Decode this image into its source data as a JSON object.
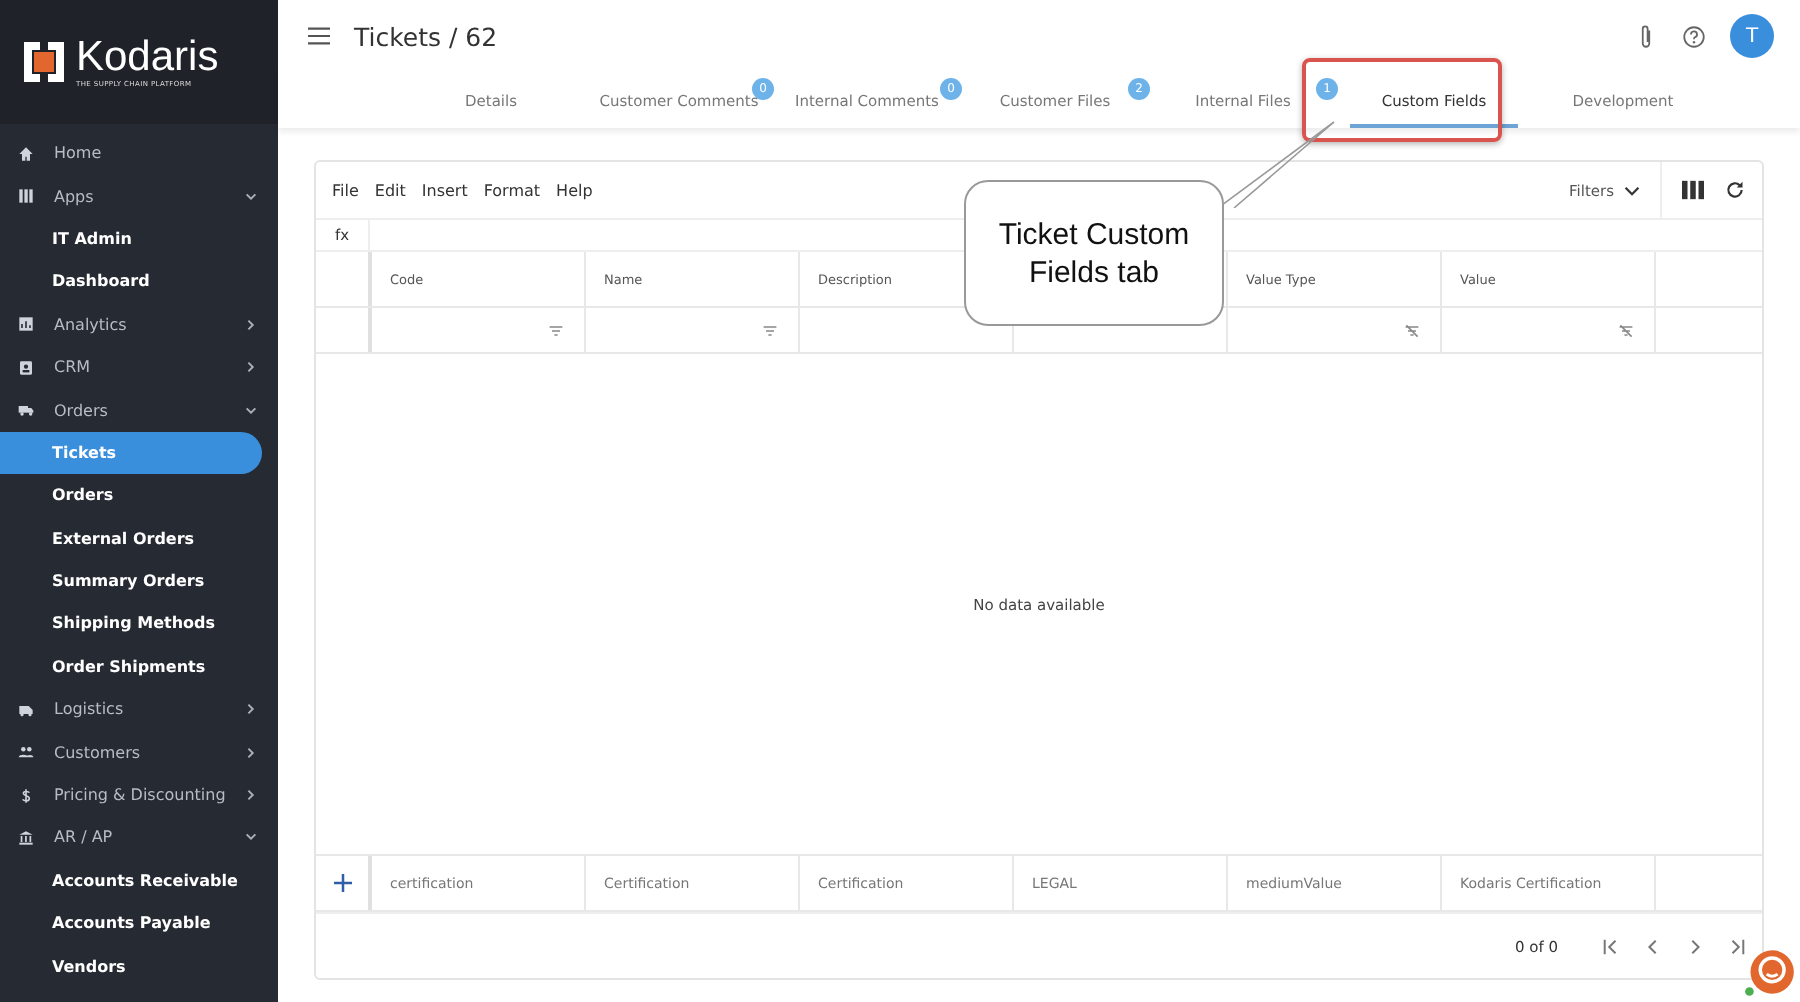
{
  "brand": {
    "name": "Kodaris",
    "tagline": "THE SUPPLY CHAIN PLATFORM"
  },
  "sidebar": {
    "items": [
      {
        "label": "Home",
        "kind": "link"
      },
      {
        "label": "Apps",
        "kind": "group",
        "expanded": true,
        "children": [
          {
            "label": "IT Admin",
            "selected": false
          },
          {
            "label": "Dashboard",
            "selected": false
          }
        ]
      },
      {
        "label": "Analytics",
        "kind": "group",
        "expanded": false
      },
      {
        "label": "CRM",
        "kind": "group",
        "expanded": false
      },
      {
        "label": "Orders",
        "kind": "group",
        "expanded": true,
        "children": [
          {
            "label": "Tickets",
            "selected": true
          },
          {
            "label": "Orders",
            "selected": false
          },
          {
            "label": "External Orders",
            "selected": false
          },
          {
            "label": "Summary Orders",
            "selected": false
          },
          {
            "label": "Shipping Methods",
            "selected": false
          },
          {
            "label": "Order Shipments",
            "selected": false
          }
        ]
      },
      {
        "label": "Logistics",
        "kind": "group",
        "expanded": false
      },
      {
        "label": "Customers",
        "kind": "group",
        "expanded": false
      },
      {
        "label": "Pricing & Discounting",
        "kind": "group",
        "expanded": false
      },
      {
        "label": "AR / AP",
        "kind": "group",
        "expanded": true,
        "children": [
          {
            "label": "Accounts Receivable",
            "selected": false
          },
          {
            "label": "Accounts Payable",
            "selected": false
          },
          {
            "label": "Vendors",
            "selected": false
          }
        ]
      }
    ]
  },
  "header": {
    "title": "Tickets / 62",
    "avatar": "T"
  },
  "tabs": [
    {
      "label": "Details",
      "selected": false
    },
    {
      "label": "Customer Comments",
      "badge": "0",
      "selected": false
    },
    {
      "label": "Internal Comments",
      "badge": "0",
      "selected": false
    },
    {
      "label": "Customer Files",
      "badge": "2",
      "selected": false
    },
    {
      "label": "Internal Files",
      "badge": "1",
      "selected": false
    },
    {
      "label": "Custom Fields",
      "selected": true
    },
    {
      "label": "Development",
      "selected": false
    }
  ],
  "grid": {
    "menu": [
      "File",
      "Edit",
      "Insert",
      "Format",
      "Help"
    ],
    "filters_label": "Filters",
    "formula_label": "fx",
    "columns": [
      {
        "label": "Code",
        "kind": "filter"
      },
      {
        "label": "Name",
        "kind": "filter"
      },
      {
        "label": "Description",
        "kind": "plain"
      },
      {
        "kind": "plain"
      },
      {
        "label": "Value Type",
        "kind": "nofilter"
      },
      {
        "label": "Value",
        "kind": "nofilter"
      }
    ],
    "empty_message": "No data available",
    "new_row": [
      "certification",
      "Certification",
      "Certification",
      "LEGAL",
      "mediumValue",
      "Kodaris Certification"
    ],
    "pagination": "0 of 0"
  },
  "callout": {
    "text": "Ticket Custom Fields tab"
  }
}
